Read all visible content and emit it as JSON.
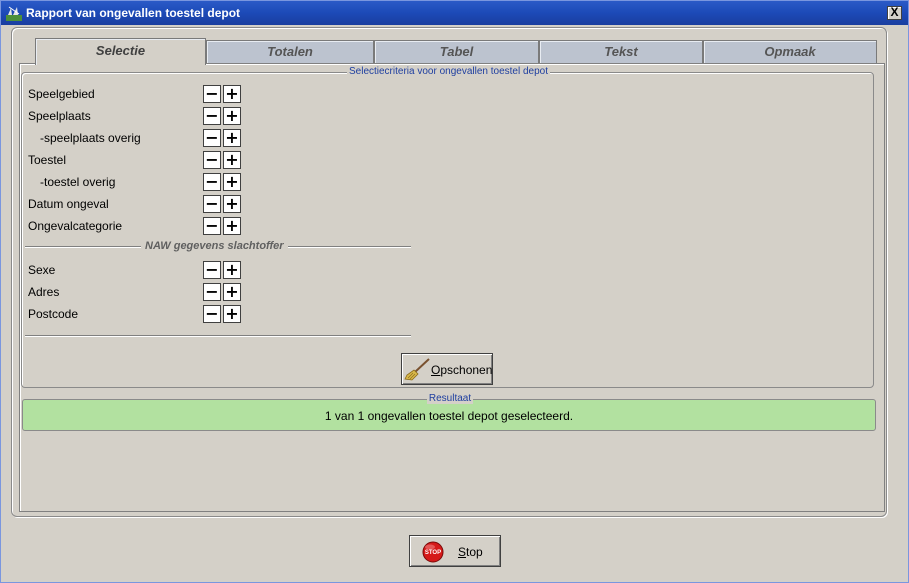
{
  "window": {
    "title": "Rapport van ongevallen toestel depot",
    "close_label": "X"
  },
  "tabs": [
    {
      "label": "Selectie",
      "active": true
    },
    {
      "label": "Totalen",
      "active": false
    },
    {
      "label": "Tabel",
      "active": false
    },
    {
      "label": "Tekst",
      "active": false
    },
    {
      "label": "Opmaak",
      "active": false
    }
  ],
  "criteria_group": {
    "title": "Selectiecriteria voor ongevallen toestel depot",
    "items": [
      {
        "label": "Speelgebied"
      },
      {
        "label": "Speelplaats"
      },
      {
        "label": "-speelplaats overig"
      },
      {
        "label": "Toestel"
      },
      {
        "label": "-toestel overig"
      },
      {
        "label": "Datum ongeval"
      },
      {
        "label": "Ongevalcategorie"
      }
    ],
    "naw_title": "NAW gegevens slachtoffer",
    "naw_items": [
      {
        "label": "Sexe"
      },
      {
        "label": "Adres"
      },
      {
        "label": "Postcode"
      }
    ],
    "minus_symbol": "−",
    "plus_symbol": "+",
    "clear_button": {
      "label": "Opschonen",
      "underline_char": "O",
      "icon": "broom-icon"
    }
  },
  "result": {
    "title": "Resultaat",
    "text": "1 van 1 ongevallen toestel depot geselecteerd.",
    "background": "#b2e1a0"
  },
  "footer": {
    "stop_button": {
      "label": "Stop",
      "icon": "stop-sign-icon",
      "icon_text": "STOP"
    }
  },
  "colors": {
    "titlebar": "#1c4ab7",
    "window": "#d4d0c8",
    "group_title": "#1f3fa0"
  }
}
